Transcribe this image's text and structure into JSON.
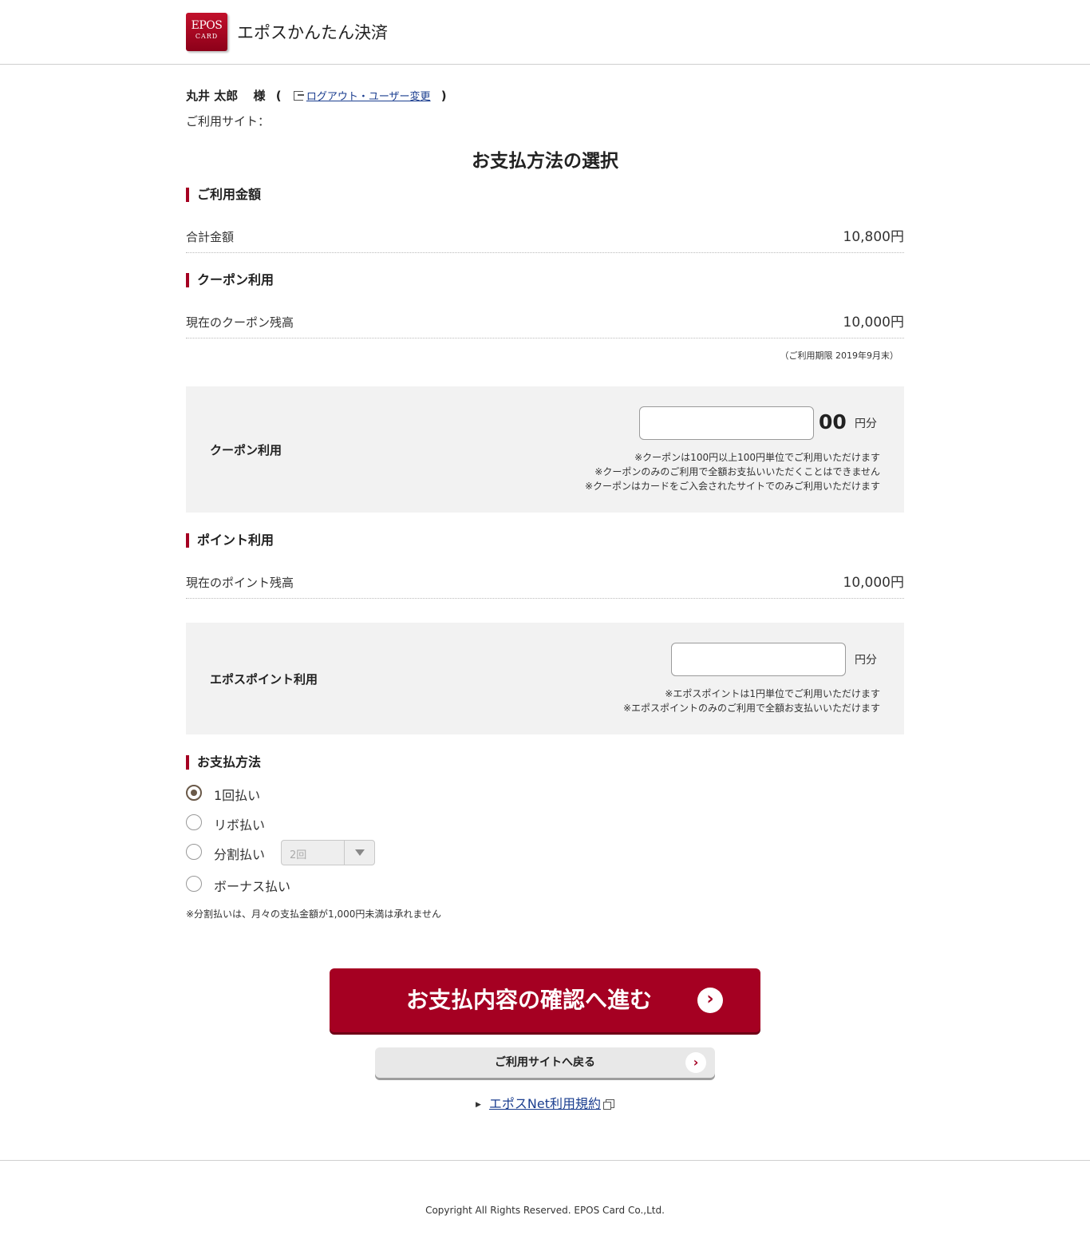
{
  "header": {
    "logo_line1": "EPOS",
    "logo_line2": "CARD",
    "app_title": "エポスかんたん決済"
  },
  "user": {
    "name": "丸井 太郎",
    "honorific": "様",
    "paren_open": "(",
    "paren_close": ")",
    "logout_link": "ログアウト・ユーザー変更",
    "site_label": "ご利用サイト："
  },
  "page_title": "お支払方法の選択",
  "usage": {
    "section": "ご利用金額",
    "total_label": "合計金額",
    "total_value": "10,800円"
  },
  "coupon": {
    "section": "クーポン利用",
    "balance_label": "現在のクーポン残高",
    "balance_value": "10,000円",
    "expiry": "（ご利用期限 2019年9月末）",
    "panel_label": "クーポン利用",
    "input_value": "",
    "zeros": "00",
    "unit": "円分",
    "notes": [
      "※クーポンは100円以上100円単位でご利用いただけます",
      "※クーポンのみのご利用で全額お支払いいただくことはできません",
      "※クーポンはカードをご入会されたサイトでのみご利用いただけます"
    ]
  },
  "points": {
    "section": "ポイント利用",
    "balance_label": "現在のポイント残高",
    "balance_value": "10,000円",
    "panel_label": "エポスポイント利用",
    "input_value": "",
    "unit": "円分",
    "notes": [
      "※エポスポイントは1円単位でご利用いただけます",
      "※エポスポイントのみのご利用で全額お支払いいただけます"
    ]
  },
  "payment": {
    "section": "お支払方法",
    "options": [
      {
        "label": "1回払い",
        "checked": true
      },
      {
        "label": "リボ払い",
        "checked": false
      },
      {
        "label": "分割払い",
        "checked": false
      },
      {
        "label": "ボーナス払い",
        "checked": false
      }
    ],
    "installment_select": "2回",
    "note": "※分割払いは、月々の支払金額が1,000円未満は承れません"
  },
  "actions": {
    "primary": "お支払内容の確認へ進む",
    "secondary": "ご利用サイトへ戻る",
    "terms_link": "エポスNet利用規約"
  },
  "footer": {
    "copyright": "Copyright All Rights Reserved. EPOS Card Co.,Ltd."
  },
  "colors": {
    "brand": "#a50022",
    "panel_bg": "#f2f2f2",
    "link": "#1a3d8f"
  }
}
